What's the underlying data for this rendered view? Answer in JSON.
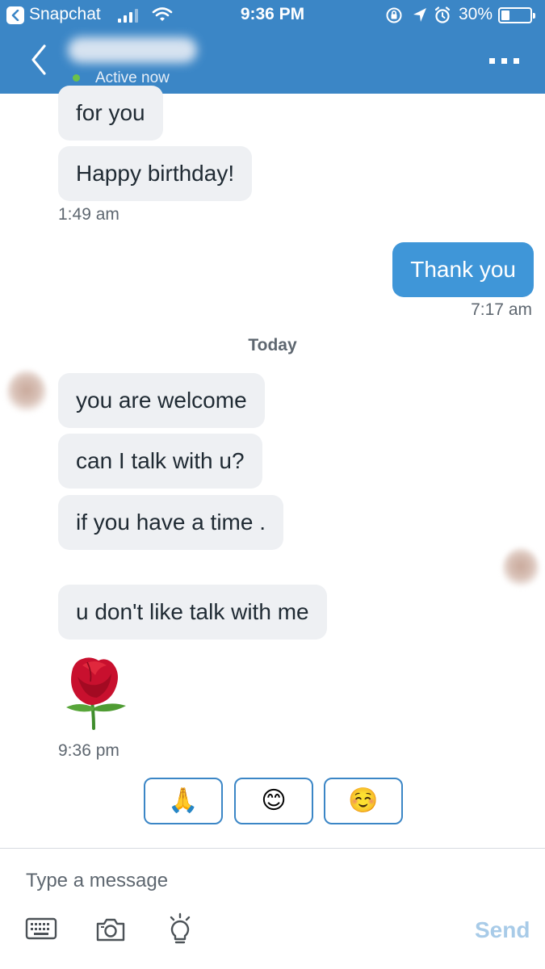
{
  "status_bar": {
    "back_app": "Snapchat",
    "time": "9:36 PM",
    "battery": "30%",
    "battery_level": 0.3
  },
  "header": {
    "presence": "Active now"
  },
  "messages": [
    {
      "text": "for you",
      "from": "them"
    },
    {
      "text": "Happy birthday!",
      "from": "them"
    },
    {
      "stamp": "1:49 am"
    },
    {
      "text": "Thank you",
      "from": "me"
    },
    {
      "stamp": "7:17 am"
    },
    {
      "day": "Today"
    },
    {
      "text": "you are welcome",
      "from": "them"
    },
    {
      "text": "can I talk with u?",
      "from": "them"
    },
    {
      "text": "if you have a time .",
      "from": "them"
    },
    {
      "text": "u don't like talk with me",
      "from": "them"
    },
    {
      "emoji": "rose"
    },
    {
      "stamp": "9:36 pm"
    }
  ],
  "quick_replies": [
    "🙏",
    "😊",
    "☺️"
  ],
  "composer": {
    "placeholder": "Type a message",
    "send_label": "Send"
  },
  "colors": {
    "brand_blue": "#3b86c6",
    "my_bubble": "#3f96d8",
    "their_bubble": "#eef0f3",
    "send_disabled": "#a8cbe8"
  }
}
